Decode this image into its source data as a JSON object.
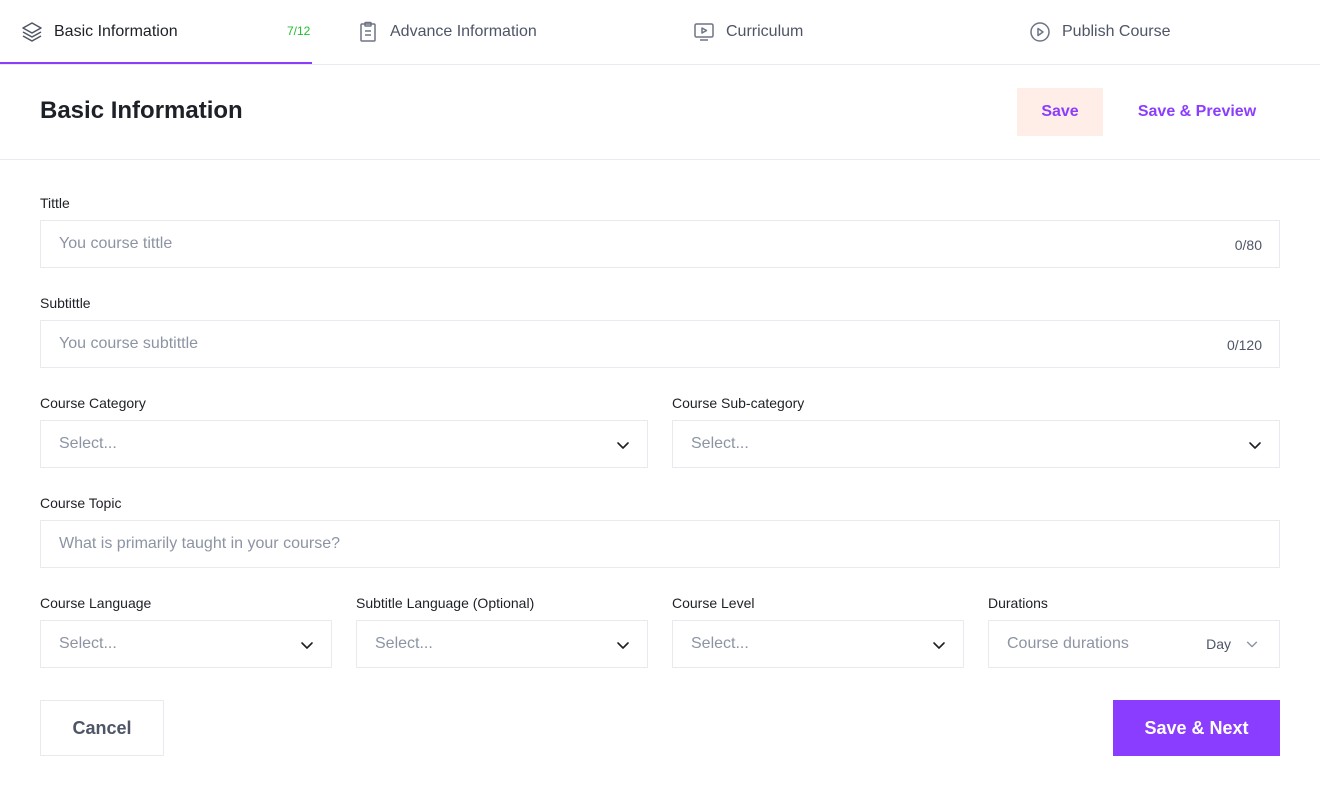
{
  "tabs": [
    {
      "label": "Basic Information",
      "icon": "stack-icon",
      "progress": "7/12",
      "active": true
    },
    {
      "label": "Advance Information",
      "icon": "clipboard-icon",
      "active": false
    },
    {
      "label": "Curriculum",
      "icon": "monitor-play-icon",
      "active": false
    },
    {
      "label": "Publish Course",
      "icon": "play-circle-icon",
      "active": false
    }
  ],
  "header": {
    "title": "Basic Information",
    "save_label": "Save",
    "preview_label": "Save & Preview"
  },
  "form": {
    "title": {
      "label": "Tittle",
      "placeholder": "You course tittle",
      "counter": "0/80"
    },
    "subtitle": {
      "label": "Subtittle",
      "placeholder": "You course subtittle",
      "counter": "0/120"
    },
    "category": {
      "label": "Course Category",
      "value": "Select..."
    },
    "subcategory": {
      "label": "Course Sub-category",
      "value": "Select..."
    },
    "topic": {
      "label": "Course Topic",
      "placeholder": "What is primarily taught in your course?"
    },
    "language": {
      "label": "Course Language",
      "value": "Select..."
    },
    "subtitle_language": {
      "label": "Subtitle Language (Optional)",
      "value": "Select..."
    },
    "level": {
      "label": "Course Level",
      "value": "Select..."
    },
    "duration": {
      "label": "Durations",
      "placeholder": "Course durations",
      "unit": "Day"
    }
  },
  "footer": {
    "cancel_label": "Cancel",
    "next_label": "Save & Next"
  },
  "colors": {
    "accent": "#8b3dff",
    "save_bg": "#ffeee8",
    "progress": "#23bd33",
    "border": "#e9eaf0",
    "placeholder": "#8c94a3"
  }
}
